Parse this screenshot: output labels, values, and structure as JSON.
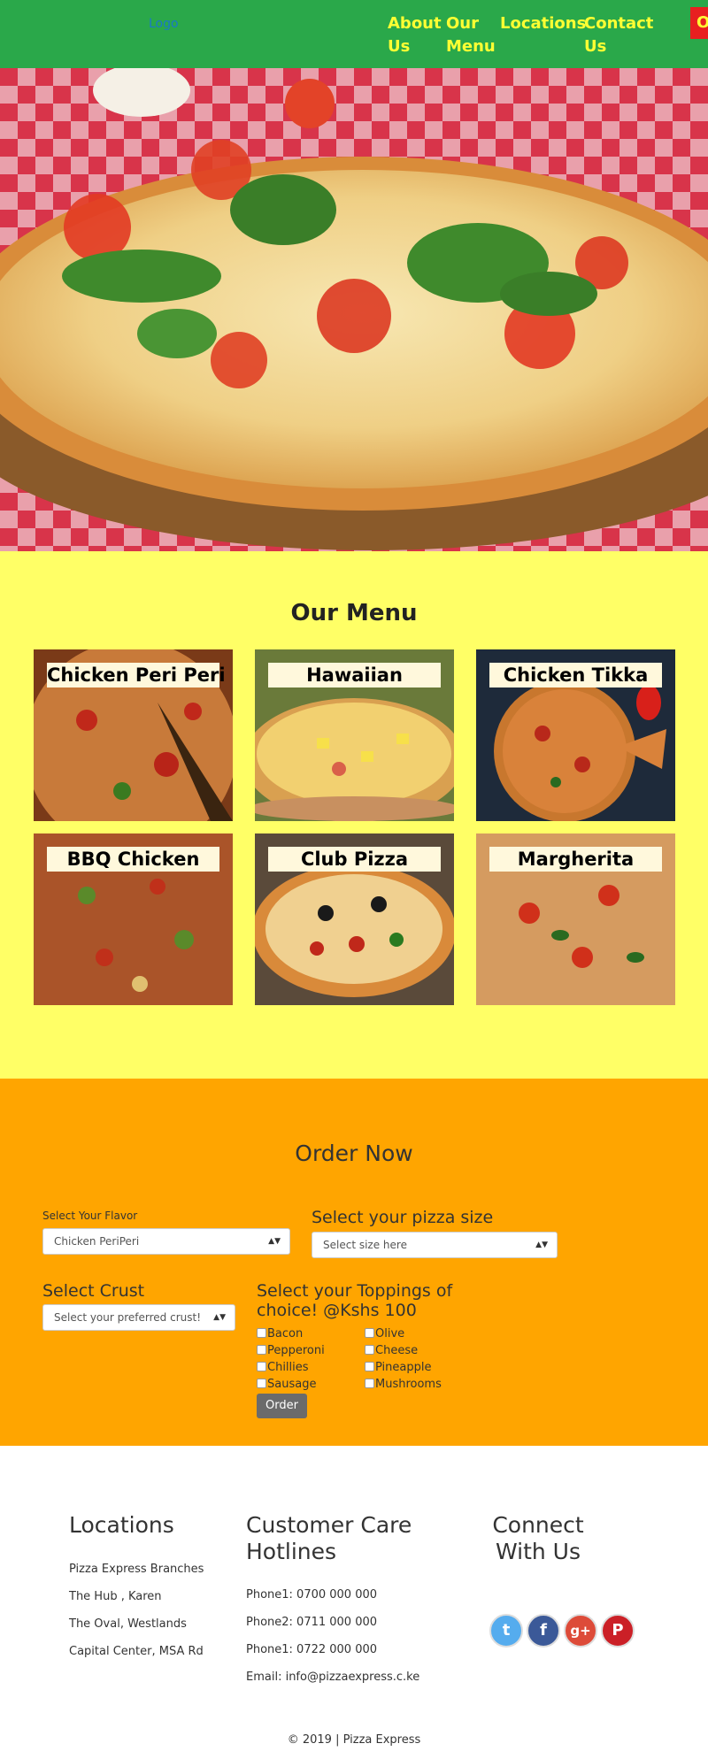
{
  "nav": {
    "logo": "Logo",
    "links": [
      "About Us",
      "Our Menu",
      "Locations",
      "Contact Us"
    ],
    "order_button": "Order"
  },
  "menu": {
    "title": "Our Menu",
    "items": [
      "Chicken Peri Peri",
      "Hawaiian",
      "Chicken Tikka",
      "BBQ Chicken",
      "Club Pizza",
      "Margherita"
    ]
  },
  "order": {
    "title": "Order Now",
    "flavor_label": "Select Your Flavor",
    "flavor_value": "Chicken PeriPeri",
    "size_label": "Select your pizza size",
    "size_value": "Select size here",
    "crust_label": "Select Crust",
    "crust_value": "Select your preferred crust!",
    "toppings_label": "Select your Toppings of choice! @Kshs 100",
    "toppings": [
      "Bacon",
      "Olive",
      "Pepperoni",
      "Cheese",
      "Chillies",
      "Pineapple",
      "Sausage",
      "Mushrooms"
    ],
    "order_button": "Order"
  },
  "footer": {
    "locations_title": "Locations",
    "locations": [
      "Pizza Express Branches",
      "The Hub , Karen",
      "The Oval, Westlands",
      "Capital Center, MSA Rd"
    ],
    "hotlines_title": "Customer Care Hotlines",
    "hotlines": [
      "Phone1: 0700 000 000",
      "Phone2: 0711 000 000",
      "Phone1: 0722 000 000",
      "Email: info@pizzaexpress.c.ke"
    ],
    "connect_title": "Connect With Us",
    "social_icons": [
      "twitter-icon",
      "facebook-icon",
      "google-plus-icon",
      "pinterest-icon"
    ],
    "social_glyphs": [
      "t",
      "f",
      "g+",
      "P"
    ],
    "copyright": "© 2019 | Pizza Express"
  },
  "colors": {
    "nav_bg": "#2aa84a",
    "nav_link": "#ffff33",
    "menu_bg": "#ffff66",
    "order_bg": "#ffa500",
    "order_button_bg": "#e82020",
    "twitter": "#55acee",
    "facebook": "#3b5998",
    "google_plus": "#dd4b39",
    "pinterest": "#cb2027"
  }
}
